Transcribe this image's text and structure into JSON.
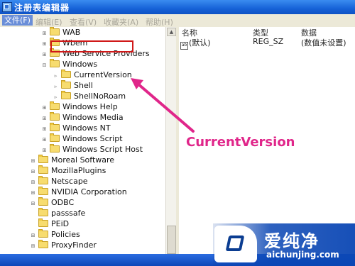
{
  "window": {
    "title": "注册表编辑器"
  },
  "menu": [
    {
      "label": "文件(F)",
      "active": true
    },
    {
      "label": "编辑(E)"
    },
    {
      "label": "查看(V)"
    },
    {
      "label": "收藏夹(A)"
    },
    {
      "label": "帮助(H)"
    }
  ],
  "tree": [
    {
      "label": "WAB",
      "level": 3
    },
    {
      "label": "Wbem",
      "level": 3
    },
    {
      "label": "Web Service Providers",
      "level": 3
    },
    {
      "label": "Windows",
      "level": 3
    },
    {
      "label": "CurrentVersion",
      "level": 4,
      "selected": true
    },
    {
      "label": "Shell",
      "level": 4
    },
    {
      "label": "ShellNoRoam",
      "level": 4
    },
    {
      "label": "Windows Help",
      "level": 3
    },
    {
      "label": "Windows Media",
      "level": 3
    },
    {
      "label": "Windows NT",
      "level": 3
    },
    {
      "label": "Windows Script",
      "level": 3
    },
    {
      "label": "Windows Script Host",
      "level": 3
    },
    {
      "label": "Moreal Software",
      "level": 2
    },
    {
      "label": "MozillaPlugins",
      "level": 2
    },
    {
      "label": "Netscape",
      "level": 2
    },
    {
      "label": "NVIDIA Corporation",
      "level": 2
    },
    {
      "label": "ODBC",
      "level": 2
    },
    {
      "label": "passsafe",
      "level": 2
    },
    {
      "label": "PEiD",
      "level": 2
    },
    {
      "label": "Policies",
      "level": 2
    },
    {
      "label": "ProxyFinder",
      "level": 2
    }
  ],
  "list": {
    "headers": {
      "name": "名称",
      "type": "类型",
      "data": "数据"
    },
    "rows": [
      {
        "name": "(默认)",
        "type": "REG_SZ",
        "data": "(数值未设置)"
      }
    ]
  },
  "annotation": {
    "text": "CurrentVersion",
    "color": "#e0268a"
  },
  "watermark": {
    "cn": "爱纯净",
    "url": "aichunjing.com"
  },
  "colors": {
    "highlight_box": "#d01818",
    "titlebar": "#1662d8"
  }
}
